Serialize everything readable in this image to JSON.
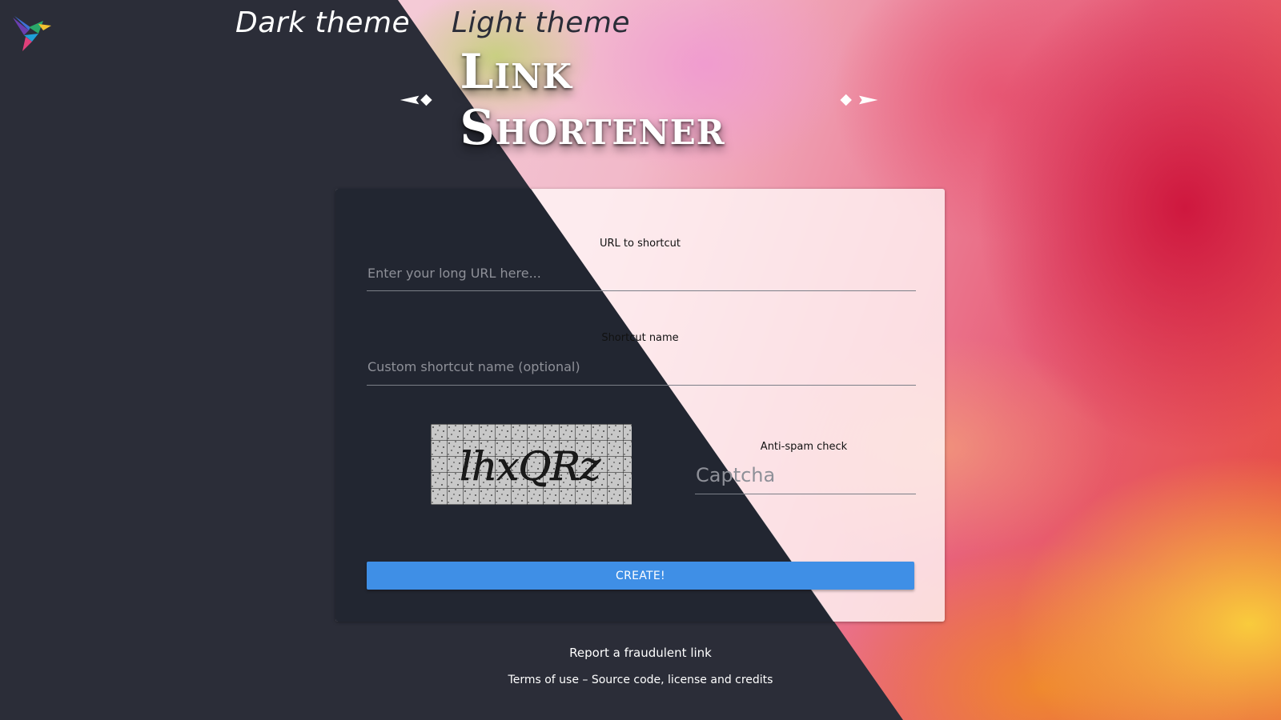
{
  "theme_switch": {
    "dark_label": "Dark theme",
    "light_label": "Light theme"
  },
  "header": {
    "title": "Link Shortener"
  },
  "form": {
    "url_field": {
      "label": "URL to shortcut",
      "placeholder": "Enter your long URL here...",
      "value": ""
    },
    "shortcut_field": {
      "label": "Shortcut name",
      "placeholder": "Custom shortcut name (optional)",
      "value": ""
    },
    "captcha_field": {
      "label": "Anti-spam check",
      "placeholder": "Captcha",
      "value": "",
      "image_text": "lhxQRz"
    },
    "submit_label": "CREATE!"
  },
  "footer": {
    "report_label": "Report a fraudulent link",
    "terms_label": "Terms of use",
    "separator": " – ",
    "source_label": "Source code, license and credits"
  },
  "colors": {
    "dark_bg": "#2b2d38",
    "card_dark": "#222631",
    "accent_button": "#3f8fe6"
  },
  "icons": {
    "logo": "hummingbird-logo-icon",
    "title_ornament": "diamond-arrow-ornament-icon"
  }
}
